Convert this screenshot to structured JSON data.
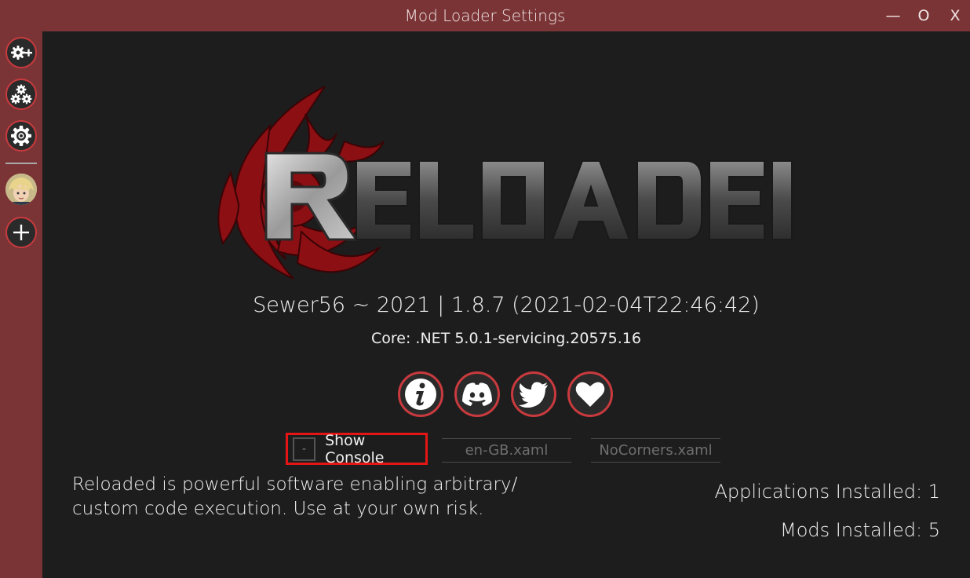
{
  "window": {
    "title": "Mod Loader Settings",
    "minimize_label": "—",
    "maximize_label": "O",
    "close_label": "X"
  },
  "colors": {
    "accent": "#7a3436",
    "button_ring": "#c93a3e",
    "highlight": "#e41515",
    "background": "#1d1d1d"
  },
  "sidebar": {
    "items": [
      {
        "name": "add-mod",
        "icon": "gear-plus-icon"
      },
      {
        "name": "manage-mods",
        "icon": "gears-icon"
      },
      {
        "name": "loader-settings",
        "icon": "gear-icon"
      },
      {
        "name": "application",
        "icon": "app-avatar-icon"
      },
      {
        "name": "add-application",
        "icon": "plus-icon"
      }
    ]
  },
  "logo": {
    "text": "RELOADED"
  },
  "version": {
    "main": "Sewer56 ~ 2021 | 1.8.7 (2021-02-04T22:46:42)",
    "core": "Core: .NET 5.0.1-servicing.20575.16"
  },
  "social": [
    "info-icon",
    "discord-icon",
    "twitter-icon",
    "heart-icon"
  ],
  "console": {
    "check_mark": "-",
    "label": "Show Console"
  },
  "language": {
    "value": "en-GB.xaml"
  },
  "theme": {
    "value": "NoCorners.xaml"
  },
  "warning": {
    "line1": "Reloaded is powerful software enabling arbitrary/",
    "line2": "custom code execution. Use at your own risk."
  },
  "stats": {
    "apps_label": "Applications Installed:",
    "apps_count": "1",
    "mods_label": "Mods Installed:",
    "mods_count": "5"
  }
}
